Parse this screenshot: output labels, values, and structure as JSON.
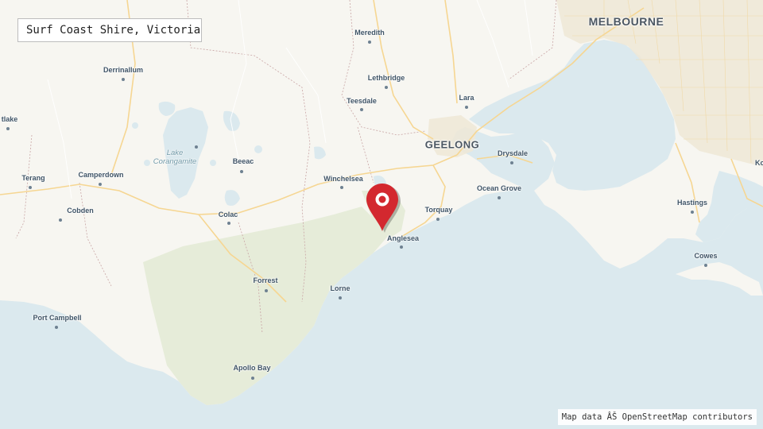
{
  "title": "Surf Coast Shire, Victoria",
  "attribution": "Map data ÂŠ OpenStreetMap contributors",
  "marker": {
    "icon": "map-pin-icon",
    "color": "#d3282f"
  },
  "colors": {
    "water": "#dbe9ee",
    "land": "#f7f6f1",
    "forest": "#e6ecd9",
    "road": "#f6d692",
    "boundary": "#c9a5a5"
  },
  "places": [
    {
      "name": "MELBOURNE",
      "type": "city"
    },
    {
      "name": "GEELONG",
      "type": "city"
    },
    {
      "name": "Meredith",
      "type": "town"
    },
    {
      "name": "Lethbridge",
      "type": "town"
    },
    {
      "name": "Teesdale",
      "type": "town"
    },
    {
      "name": "Lara",
      "type": "town"
    },
    {
      "name": "Derrinallum",
      "type": "town"
    },
    {
      "name": "tlake",
      "type": "town"
    },
    {
      "name": "Lake Corangamite",
      "type": "water"
    },
    {
      "name": "Beeac",
      "type": "town"
    },
    {
      "name": "Camperdown",
      "type": "town"
    },
    {
      "name": "Terang",
      "type": "town"
    },
    {
      "name": "Cobden",
      "type": "town"
    },
    {
      "name": "Colac",
      "type": "town"
    },
    {
      "name": "Winchelsea",
      "type": "town"
    },
    {
      "name": "Drysdale",
      "type": "town"
    },
    {
      "name": "Ocean Grove",
      "type": "town"
    },
    {
      "name": "Torquay",
      "type": "town"
    },
    {
      "name": "Anglesea",
      "type": "town"
    },
    {
      "name": "Forrest",
      "type": "town"
    },
    {
      "name": "Lorne",
      "type": "town"
    },
    {
      "name": "Port Campbell",
      "type": "town"
    },
    {
      "name": "Apollo Bay",
      "type": "town"
    },
    {
      "name": "Hastings",
      "type": "town"
    },
    {
      "name": "Cowes",
      "type": "town"
    },
    {
      "name": "Ko",
      "type": "town"
    }
  ]
}
